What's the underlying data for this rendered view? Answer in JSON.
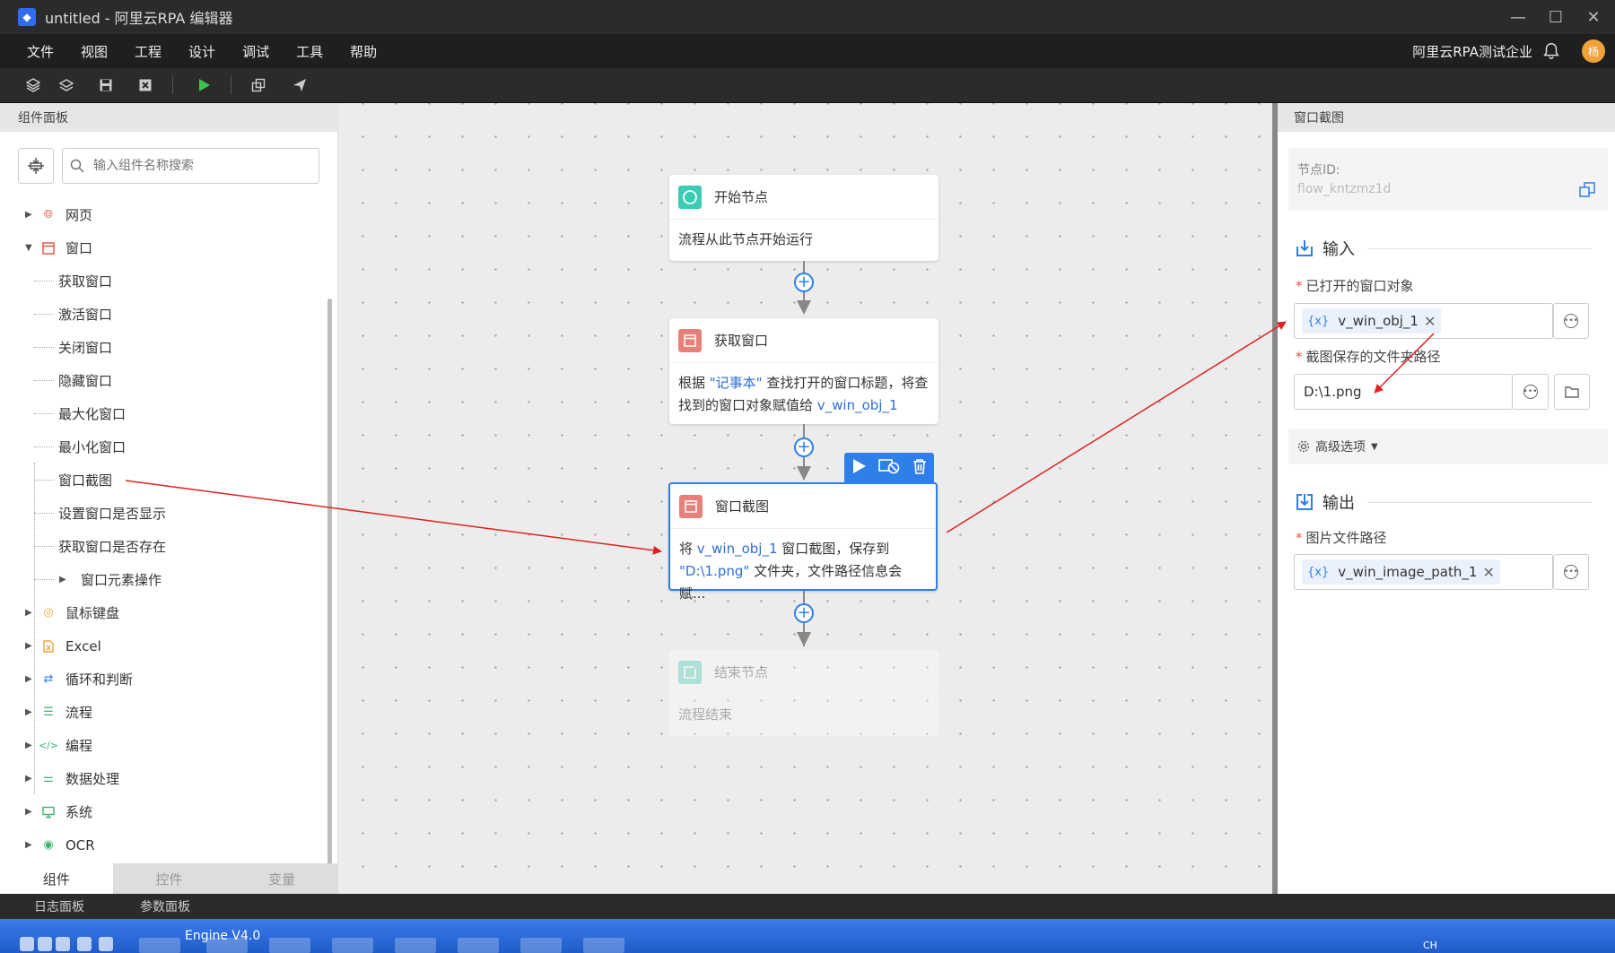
{
  "window": {
    "app_icon": "rpa-logo-icon",
    "title": "untitled - 阿里云RPA 编辑器",
    "controls": [
      "minimize-icon",
      "maximize-icon",
      "close-icon"
    ]
  },
  "menu": {
    "items": [
      "文件",
      "视图",
      "工程",
      "设计",
      "调试",
      "工具",
      "帮助"
    ],
    "org_name": "阿里云RPA测试企业",
    "avatar_text": "杨"
  },
  "toolbar": {
    "buttons": [
      "layers-icon",
      "layers-outline-icon",
      "save-icon",
      "close-box-icon",
      "run-icon",
      "copy-icon",
      "send-icon"
    ]
  },
  "left_panel": {
    "title": "组件面板",
    "search_placeholder": "输入组件名称搜索",
    "categories": [
      {
        "label": "网页",
        "icon": "globe-icon",
        "color": "#e05a4f",
        "expanded": false
      },
      {
        "label": "窗口",
        "icon": "window-icon",
        "color": "#e05a4f",
        "expanded": true,
        "children": [
          "获取窗口",
          "激活窗口",
          "关闭窗口",
          "隐藏窗口",
          "最大化窗口",
          "最小化窗口",
          "窗口截图",
          "设置窗口是否显示",
          "获取窗口是否存在"
        ],
        "subgroup": "窗口元素操作"
      },
      {
        "label": "鼠标键盘",
        "icon": "mouse-icon",
        "color": "#f0a23a",
        "expanded": false
      },
      {
        "label": "Excel",
        "icon": "excel-icon",
        "color": "#f0a23a",
        "expanded": false
      },
      {
        "label": "循环和判断",
        "icon": "loop-icon",
        "color": "#2e7fe8",
        "expanded": false
      },
      {
        "label": "流程",
        "icon": "flow-icon",
        "color": "#3cb371",
        "expanded": false
      },
      {
        "label": "编程",
        "icon": "code-icon",
        "color": "#3cb371",
        "expanded": false
      },
      {
        "label": "数据处理",
        "icon": "data-icon",
        "color": "#3cb371",
        "expanded": false
      },
      {
        "label": "系统",
        "icon": "monitor-icon",
        "color": "#3cb371",
        "expanded": false
      },
      {
        "label": "OCR",
        "icon": "eye-icon",
        "color": "#3cb371",
        "expanded": false
      }
    ],
    "tabs": [
      "组件",
      "控件",
      "变量"
    ],
    "active_tab": "组件"
  },
  "canvas": {
    "nodes": [
      {
        "title": "开始节点",
        "body": "流程从此节点开始运行",
        "icon": "start-node-icon",
        "color": "#3ccbb4"
      },
      {
        "title": "获取窗口",
        "body_parts": [
          "根据 ",
          "\"记事本\"",
          " 查找打开的窗口标题，将查找到的窗口对象赋值给 ",
          "v_win_obj_1"
        ],
        "icon": "window-node-icon",
        "color": "#e8807a"
      },
      {
        "title": "窗口截图",
        "body_parts": [
          "将 ",
          "v_win_obj_1",
          " 窗口截图，保存到 ",
          "\"D:\\1.png\"",
          " 文件夹，文件路径信息会赋..."
        ],
        "icon": "window-node-icon",
        "color": "#e8807a"
      },
      {
        "title": "结束节点",
        "body": "流程结束",
        "icon": "end-node-icon",
        "color": "#3ccbb4"
      }
    ],
    "node_actions": [
      "play-icon",
      "disable-icon",
      "trash-icon"
    ]
  },
  "right_panel": {
    "title": "窗口截图",
    "node_id_label": "节点ID:",
    "node_id_value": "flow_kntzmz1d",
    "input_section": "输入",
    "field1_label": "已打开的窗口对象",
    "field1_value": "v_win_obj_1",
    "field2_label": "截图保存的文件夹路径",
    "field2_value": "D:\\1.png",
    "advanced": "高级选项",
    "output_section": "输出",
    "field3_label": "图片文件路径",
    "field3_value": "v_win_image_path_1",
    "var_tag": "{x}"
  },
  "bottom_panel": {
    "tabs": [
      "日志面板",
      "参数面板"
    ]
  },
  "taskbar": {
    "engine_label": "Engine V4.0",
    "ime": "CH"
  },
  "colors": {
    "accent": "#2e7fe8",
    "arrow": "#e02020"
  }
}
